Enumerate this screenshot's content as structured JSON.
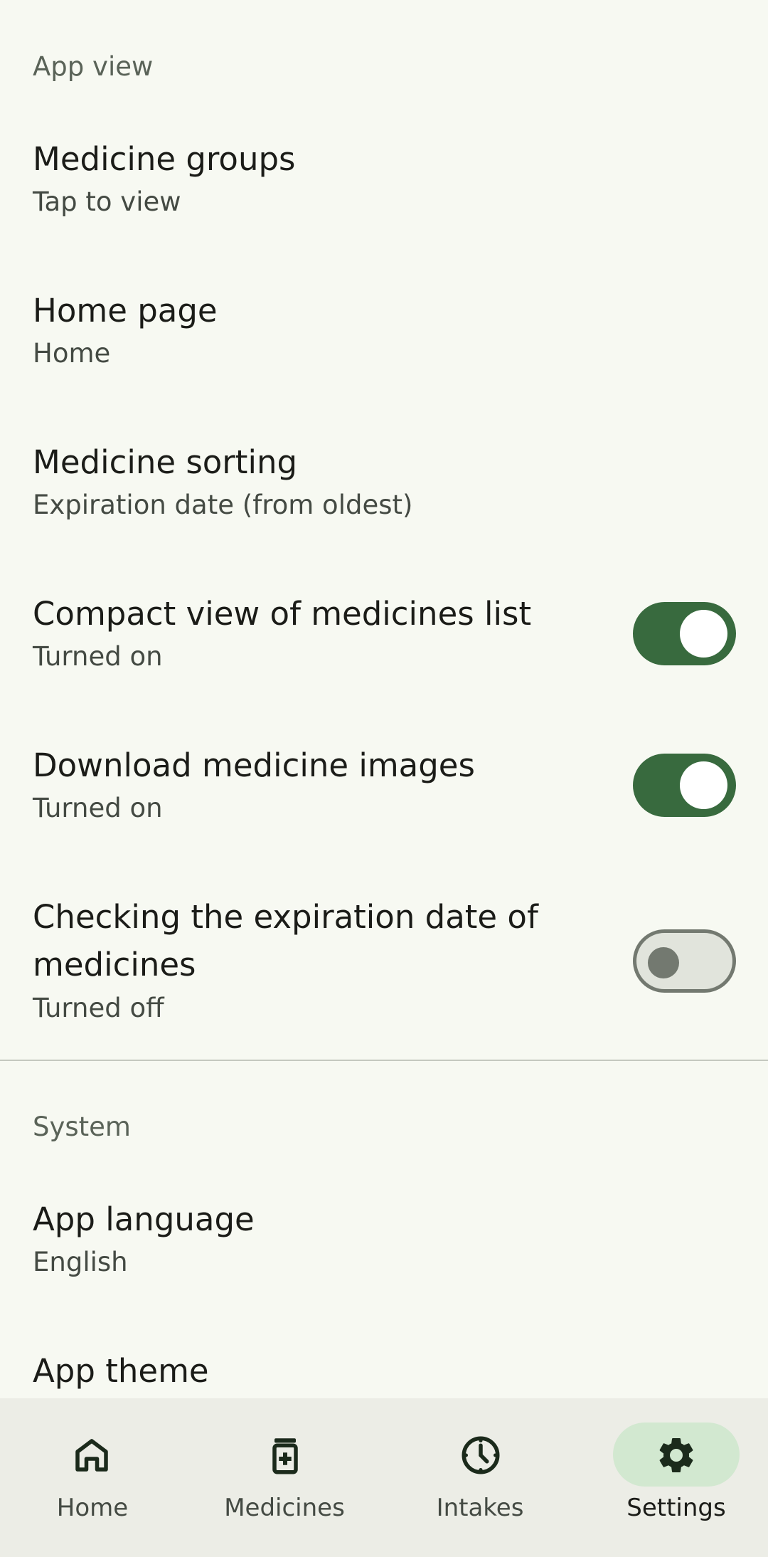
{
  "sections": {
    "app_view": "App view",
    "system": "System"
  },
  "items": {
    "medicine_groups": {
      "title": "Medicine groups",
      "subtitle": "Tap to view"
    },
    "home_page": {
      "title": "Home page",
      "subtitle": "Home"
    },
    "medicine_sorting": {
      "title": "Medicine sorting",
      "subtitle": "Expiration date (from oldest)"
    },
    "compact_view": {
      "title": "Compact view of medicines list",
      "subtitle": "Turned on",
      "enabled": true
    },
    "download_images": {
      "title": "Download medicine images",
      "subtitle": "Turned on",
      "enabled": true
    },
    "expiration_check": {
      "title_line1": "Checking the expiration date of",
      "title_line2": "medicines",
      "subtitle": "Turned off",
      "enabled": false
    },
    "app_language": {
      "title": "App language",
      "subtitle": "English"
    },
    "app_theme": {
      "title": "App theme"
    }
  },
  "nav": {
    "home": {
      "label": "Home",
      "icon": "home-icon"
    },
    "medicines": {
      "label": "Medicines",
      "icon": "medicine-bottle-icon"
    },
    "intakes": {
      "label": "Intakes",
      "icon": "clock-icon"
    },
    "settings": {
      "label": "Settings",
      "icon": "gear-icon",
      "active": true
    }
  },
  "colors": {
    "background": "#f7f9f2",
    "accent": "#386a3e",
    "nav_background": "#ecede6",
    "active_pill": "#d2e8d0"
  }
}
